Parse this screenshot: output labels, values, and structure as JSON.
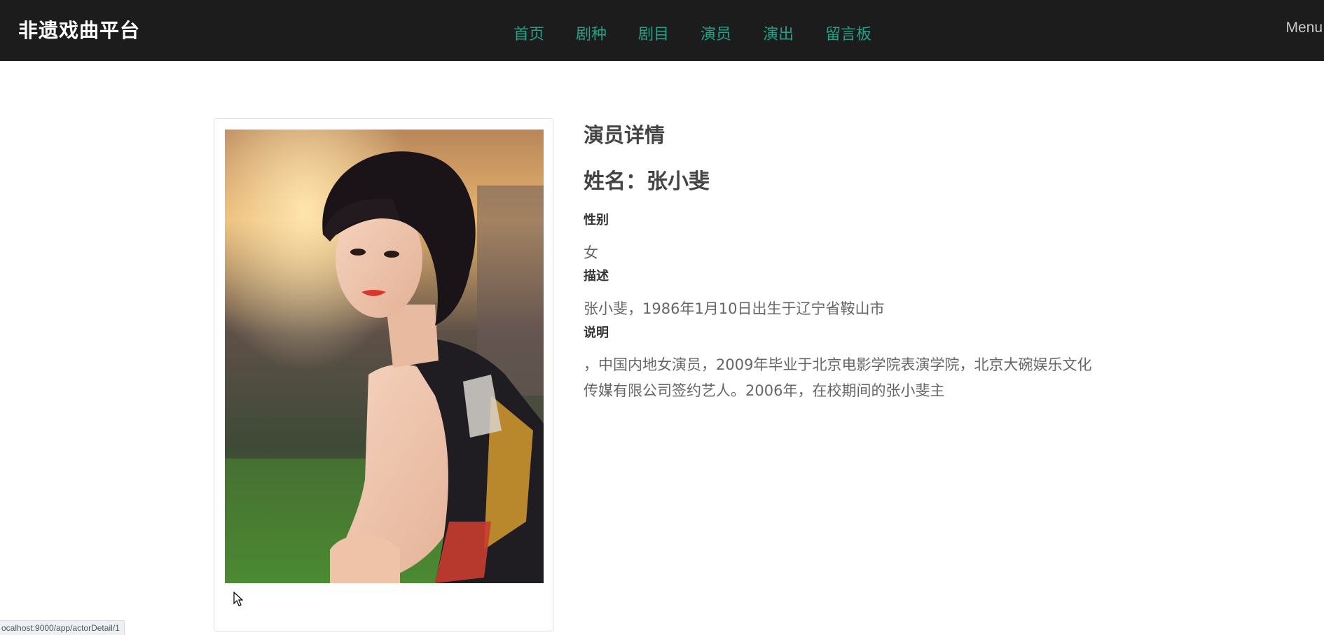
{
  "header": {
    "brand": "非遗戏曲平台",
    "nav": [
      {
        "label": "首页"
      },
      {
        "label": "剧种"
      },
      {
        "label": "剧目"
      },
      {
        "label": "演员"
      },
      {
        "label": "演出"
      },
      {
        "label": "留言板"
      }
    ],
    "menu_label": "Menu",
    "background_color": "#1c1c1c",
    "link_color": "#22a189"
  },
  "actor": {
    "section_title": "演员详情",
    "name_line": "姓名：张小斐",
    "gender_label": "性别",
    "gender": "女",
    "description_label": "描述",
    "description": "张小斐，1986年1月10日出生于辽宁省鞍山市",
    "notes_label": "说明",
    "notes": "，中国内地女演员，2009年毕业于北京电影学院表演学院，北京大碗娱乐文化传媒有限公司签约艺人。2006年，在校期间的张小斐主"
  },
  "status_bar": {
    "url": "ocalhost:9000/app/actorDetail/1"
  }
}
